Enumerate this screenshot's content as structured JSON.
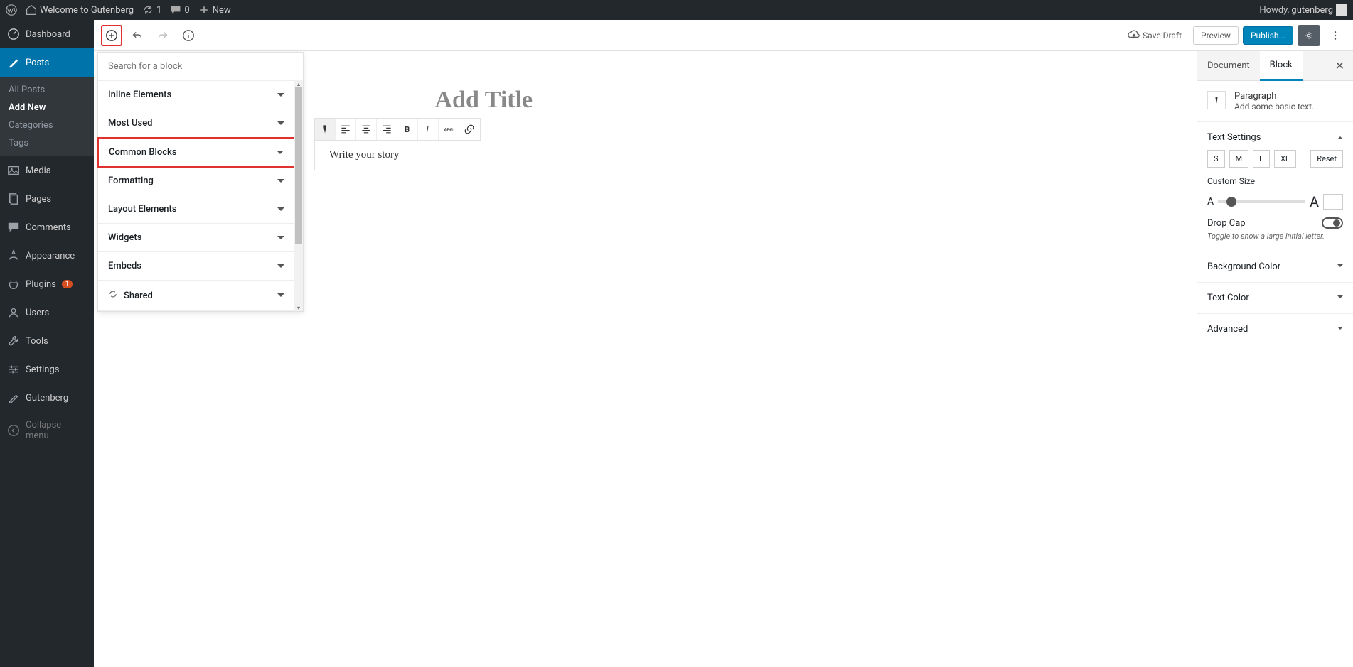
{
  "adminbar": {
    "site": "Welcome to Gutenberg",
    "updates": "1",
    "comments": "0",
    "new": "New",
    "howdy": "Howdy, gutenberg"
  },
  "sidebar": {
    "dashboard": "Dashboard",
    "posts": "Posts",
    "posts_sub": {
      "all": "All Posts",
      "add": "Add New",
      "cat": "Categories",
      "tags": "Tags"
    },
    "media": "Media",
    "pages": "Pages",
    "comments": "Comments",
    "appearance": "Appearance",
    "plugins": "Plugins",
    "plugins_badge": "1",
    "users": "Users",
    "tools": "Tools",
    "settings": "Settings",
    "gutenberg": "Gutenberg",
    "collapse": "Collapse menu"
  },
  "toolbar": {
    "savedraft": "Save Draft",
    "preview": "Preview",
    "publish": "Publish..."
  },
  "inserter": {
    "search_placeholder": "Search for a block",
    "cats": {
      "inline": "Inline Elements",
      "most": "Most Used",
      "common": "Common Blocks",
      "formatting": "Formatting",
      "layout": "Layout Elements",
      "widgets": "Widgets",
      "embeds": "Embeds",
      "shared": "Shared"
    }
  },
  "canvas": {
    "title_placeholder": "Add Title",
    "para_placeholder": "Write your story"
  },
  "rside": {
    "tabs": {
      "doc": "Document",
      "block": "Block"
    },
    "block": {
      "name": "Paragraph",
      "desc": "Add some basic text."
    },
    "text_settings": {
      "label": "Text Settings",
      "sizes": {
        "s": "S",
        "m": "M",
        "l": "L",
        "xl": "XL"
      },
      "reset": "Reset",
      "custom": "Custom Size",
      "dropcap": "Drop Cap",
      "dropcap_help": "Toggle to show a large initial letter."
    },
    "bg": "Background Color",
    "tc": "Text Color",
    "adv": "Advanced"
  }
}
